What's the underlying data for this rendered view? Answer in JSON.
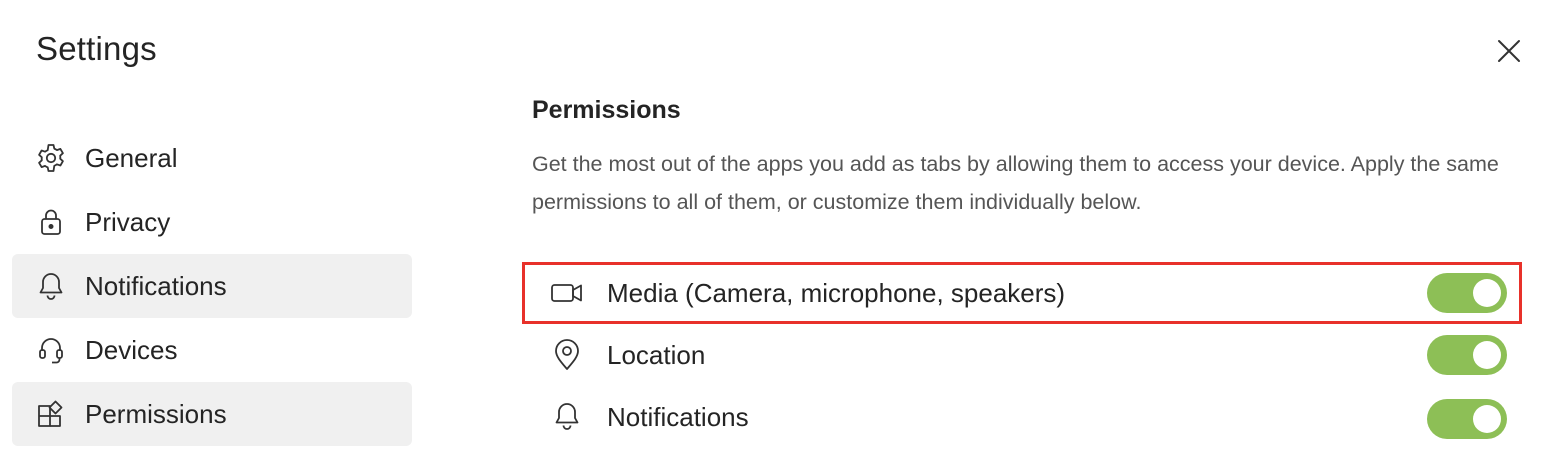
{
  "dialog": {
    "title": "Settings",
    "close_icon": "close-icon"
  },
  "sidebar": {
    "items": [
      {
        "label": "General",
        "icon": "gear-icon",
        "selected": false
      },
      {
        "label": "Privacy",
        "icon": "lock-icon",
        "selected": false
      },
      {
        "label": "Notifications",
        "icon": "bell-icon",
        "selected": true
      },
      {
        "label": "Devices",
        "icon": "headset-icon",
        "selected": false
      },
      {
        "label": "Permissions",
        "icon": "apps-icon",
        "selected": true
      }
    ]
  },
  "permissions": {
    "title": "Permissions",
    "description": "Get the most out of the apps you add as tabs by allowing them to access your device. Apply the same permissions to all of them, or customize them individually below.",
    "items": [
      {
        "label": "Media (Camera, microphone, speakers)",
        "icon": "video-camera-icon",
        "enabled": true,
        "highlighted": true
      },
      {
        "label": "Location",
        "icon": "location-pin-icon",
        "enabled": true,
        "highlighted": false
      },
      {
        "label": "Notifications",
        "icon": "bell-icon",
        "enabled": true,
        "highlighted": false
      }
    ]
  },
  "colors": {
    "toggle_on": "#8dbf56",
    "highlight_border": "#e8312a",
    "selected_bg": "#f0f0f0"
  }
}
